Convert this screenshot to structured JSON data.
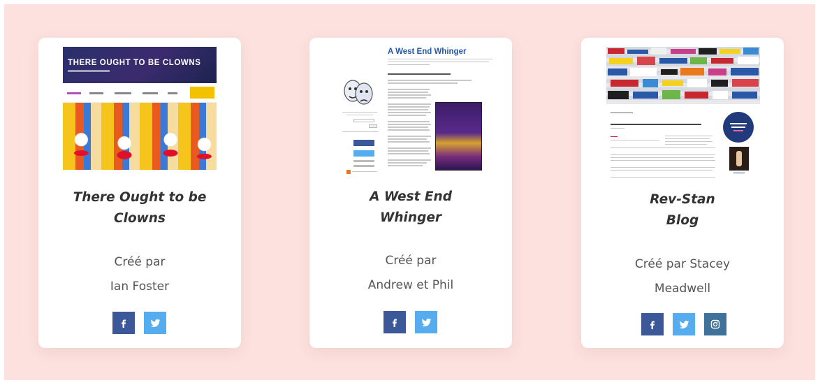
{
  "cards": [
    {
      "title_line1": "There Ought to be",
      "title_line2": "Clowns",
      "author_line1": "Créé par",
      "author_line2": "Ian Foster",
      "socials": [
        "facebook",
        "twitter"
      ],
      "thumbnail": {
        "banner_text": "THERE OUGHT TO BE CLOWNS"
      }
    },
    {
      "title_line1": "A West End",
      "title_line2": "Whinger",
      "author_line1": "Créé par",
      "author_line2": "Andrew et Phil",
      "socials": [
        "facebook",
        "twitter"
      ],
      "thumbnail": {
        "header_text": "A West End Whinger"
      }
    },
    {
      "title_line1": "Rev-Stan",
      "title_line2": "Blog",
      "author_line1": "Créé par Stacey",
      "author_line2": "Meadwell",
      "socials": [
        "facebook",
        "twitter",
        "instagram"
      ]
    }
  ],
  "colors": {
    "background": "#fce1de",
    "card": "#ffffff",
    "facebook": "#3b5998",
    "twitter": "#55acee",
    "instagram": "#3f729b"
  },
  "icons": {
    "facebook": "facebook-icon",
    "twitter": "twitter-icon",
    "instagram": "instagram-icon"
  }
}
